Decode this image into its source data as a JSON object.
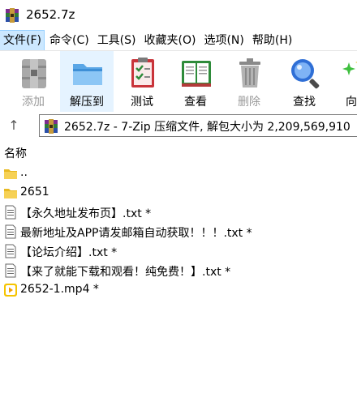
{
  "window": {
    "title": "2652.7z"
  },
  "menu": [
    {
      "label": "文件(F)"
    },
    {
      "label": "命令(C)"
    },
    {
      "label": "工具(S)"
    },
    {
      "label": "收藏夹(O)"
    },
    {
      "label": "选项(N)"
    },
    {
      "label": "帮助(H)"
    }
  ],
  "toolbar": {
    "add": "添加",
    "extract": "解压到",
    "test": "测试",
    "view": "查看",
    "delete": "删除",
    "find": "查找",
    "wizard": "向"
  },
  "address": {
    "text": "2652.7z - 7-Zip 压缩文件, 解包大小为 2,209,569,910"
  },
  "list": {
    "column_name": "名称",
    "items": [
      {
        "name": "..",
        "icon": "folder-icon"
      },
      {
        "name": "2651",
        "icon": "folder-icon"
      },
      {
        "name": "【永久地址发布页】.txt *",
        "icon": "text-file-icon"
      },
      {
        "name": "最新地址及APP请发邮箱自动获取！！！.txt *",
        "icon": "text-file-icon"
      },
      {
        "name": "【论坛介绍】.txt *",
        "icon": "text-file-icon"
      },
      {
        "name": "【来了就能下载和观看！纯免费！】.txt *",
        "icon": "text-file-icon"
      },
      {
        "name": "2652-1.mp4 *",
        "icon": "video-file-icon"
      }
    ]
  },
  "colors": {
    "menu_highlight": "#cce8ff",
    "selected_tool": "#e5f3ff",
    "folder": "#f0c419",
    "video": "#f5c400"
  }
}
